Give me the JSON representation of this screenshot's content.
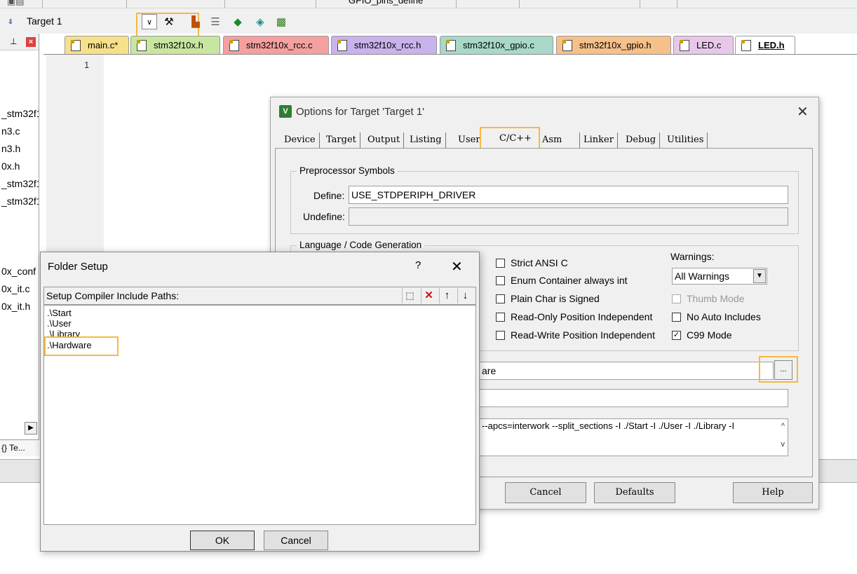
{
  "toolbar": {
    "target_name": "Target 1",
    "top_file_label": "GPIO_pins_define"
  },
  "left_panel": {
    "files": [
      "_stm32f1",
      "n3.c",
      "n3.h",
      "0x.h",
      "_stm32f1",
      "_stm32f1",
      "0x_conf",
      "0x_it.c",
      "0x_it.h"
    ],
    "bottom_tab": "Te..."
  },
  "editor": {
    "tabs": [
      "main.c*",
      "stm32f10x.h",
      "stm32f10x_rcc.c",
      "stm32f10x_rcc.h",
      "stm32f10x_gpio.c",
      "stm32f10x_gpio.h",
      "LED.c",
      "LED.h"
    ],
    "line_number": "1"
  },
  "options_dialog": {
    "title": "Options for Target 'Target 1'",
    "tabs": [
      "Device",
      "Target",
      "Output",
      "Listing",
      "User",
      "C/C++",
      "Asm",
      "Linker",
      "Debug",
      "Utilities"
    ],
    "preprocessor": {
      "group_title": "Preprocessor Symbols",
      "define_label": "Define:",
      "define_value": "USE_STDPERIPH_DRIVER",
      "undefine_label": "Undefine:",
      "undefine_value": ""
    },
    "language": {
      "group_title": "Language / Code Generation",
      "options": [
        {
          "label": "Strict ANSI C",
          "checked": false
        },
        {
          "label": "Enum Container always int",
          "checked": false
        },
        {
          "label": "Plain Char is Signed",
          "checked": false
        },
        {
          "label": "Read-Only Position Independent",
          "checked": false
        },
        {
          "label": "Read-Write Position Independent",
          "checked": false
        }
      ],
      "warnings_label": "Warnings:",
      "warnings_value": "All Warnings",
      "thumb_mode": "Thumb Mode",
      "no_auto_includes": "No Auto Includes",
      "c99_mode": "C99 Mode",
      "c99_checked": true
    },
    "include_paths_tail": "are",
    "browse_label": "...",
    "compiler_control": "--apcs=interwork --split_sections -I ./Start -I ./User -I ./Library -I",
    "buttons": {
      "cancel": "Cancel",
      "defaults": "Defaults",
      "help": "Help"
    }
  },
  "folder_dialog": {
    "title": "Folder Setup",
    "help": "?",
    "header_label": "Setup Compiler Include Paths:",
    "paths": [
      ".\\Start",
      ".\\User",
      ".\\Library",
      ".\\Hardware"
    ],
    "buttons": {
      "ok": "OK",
      "cancel": "Cancel"
    }
  },
  "colors": {
    "highlight": "#f5b942",
    "tab_main": "#f7e08a",
    "tab_h": "#c8e6a0",
    "tab_rcc": "#f4a0a0",
    "tab_rcc_h": "#c9b3ec",
    "tab_gpio": "#a8d8c8",
    "tab_gpio_h": "#f6c08a",
    "tab_led_c": "#e8c8e8",
    "tab_led_h": "#ffffff"
  }
}
